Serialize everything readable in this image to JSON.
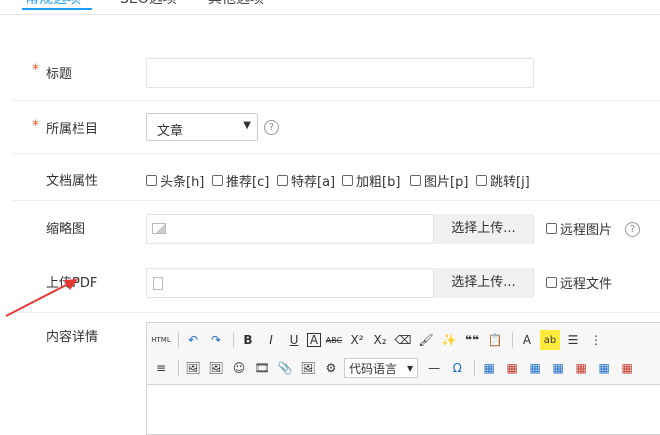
{
  "tabs": [
    {
      "label": "常规选项"
    },
    {
      "label": "SEO选项"
    },
    {
      "label": "其他选项"
    }
  ],
  "form": {
    "required_mark": "*",
    "title_label": "标题",
    "title_value": "",
    "category_label": "所属栏目",
    "category_value": "文章",
    "help_glyph": "?",
    "attr_label": "文档属性",
    "attributes": [
      "头条[h]",
      "推荐[c]",
      "特荐[a]",
      "加粗[b]",
      "图片[p]",
      "跳转[j]"
    ],
    "thumb_label": "缩略图",
    "thumb_button": "选择上传...",
    "thumb_remote": "远程图片",
    "pdf_label": "上传PDF",
    "pdf_button": "选择上传...",
    "pdf_remote": "远程文件",
    "content_label": "内容详情"
  },
  "editor": {
    "row1": [
      "HTML",
      "↶",
      "↷",
      "B",
      "I",
      "U",
      "A",
      "ABC",
      "X²",
      "X₂",
      "⌫",
      "🖌",
      "✨",
      "❝❝",
      "📋",
      "A",
      "ab",
      "☰",
      "⋮"
    ],
    "row2": [
      "≡",
      "🖼",
      "🖼",
      "☺",
      "🎞",
      "📎",
      "🖼",
      "⚙",
      "—",
      "Ω",
      "▦",
      "▦",
      "▦",
      "▦",
      "▦",
      "▦",
      "▦"
    ],
    "code_language": "代码语言"
  },
  "colors": {
    "accent": "#1e9fff",
    "required": "#ff5722",
    "arrow": "#e53935"
  }
}
